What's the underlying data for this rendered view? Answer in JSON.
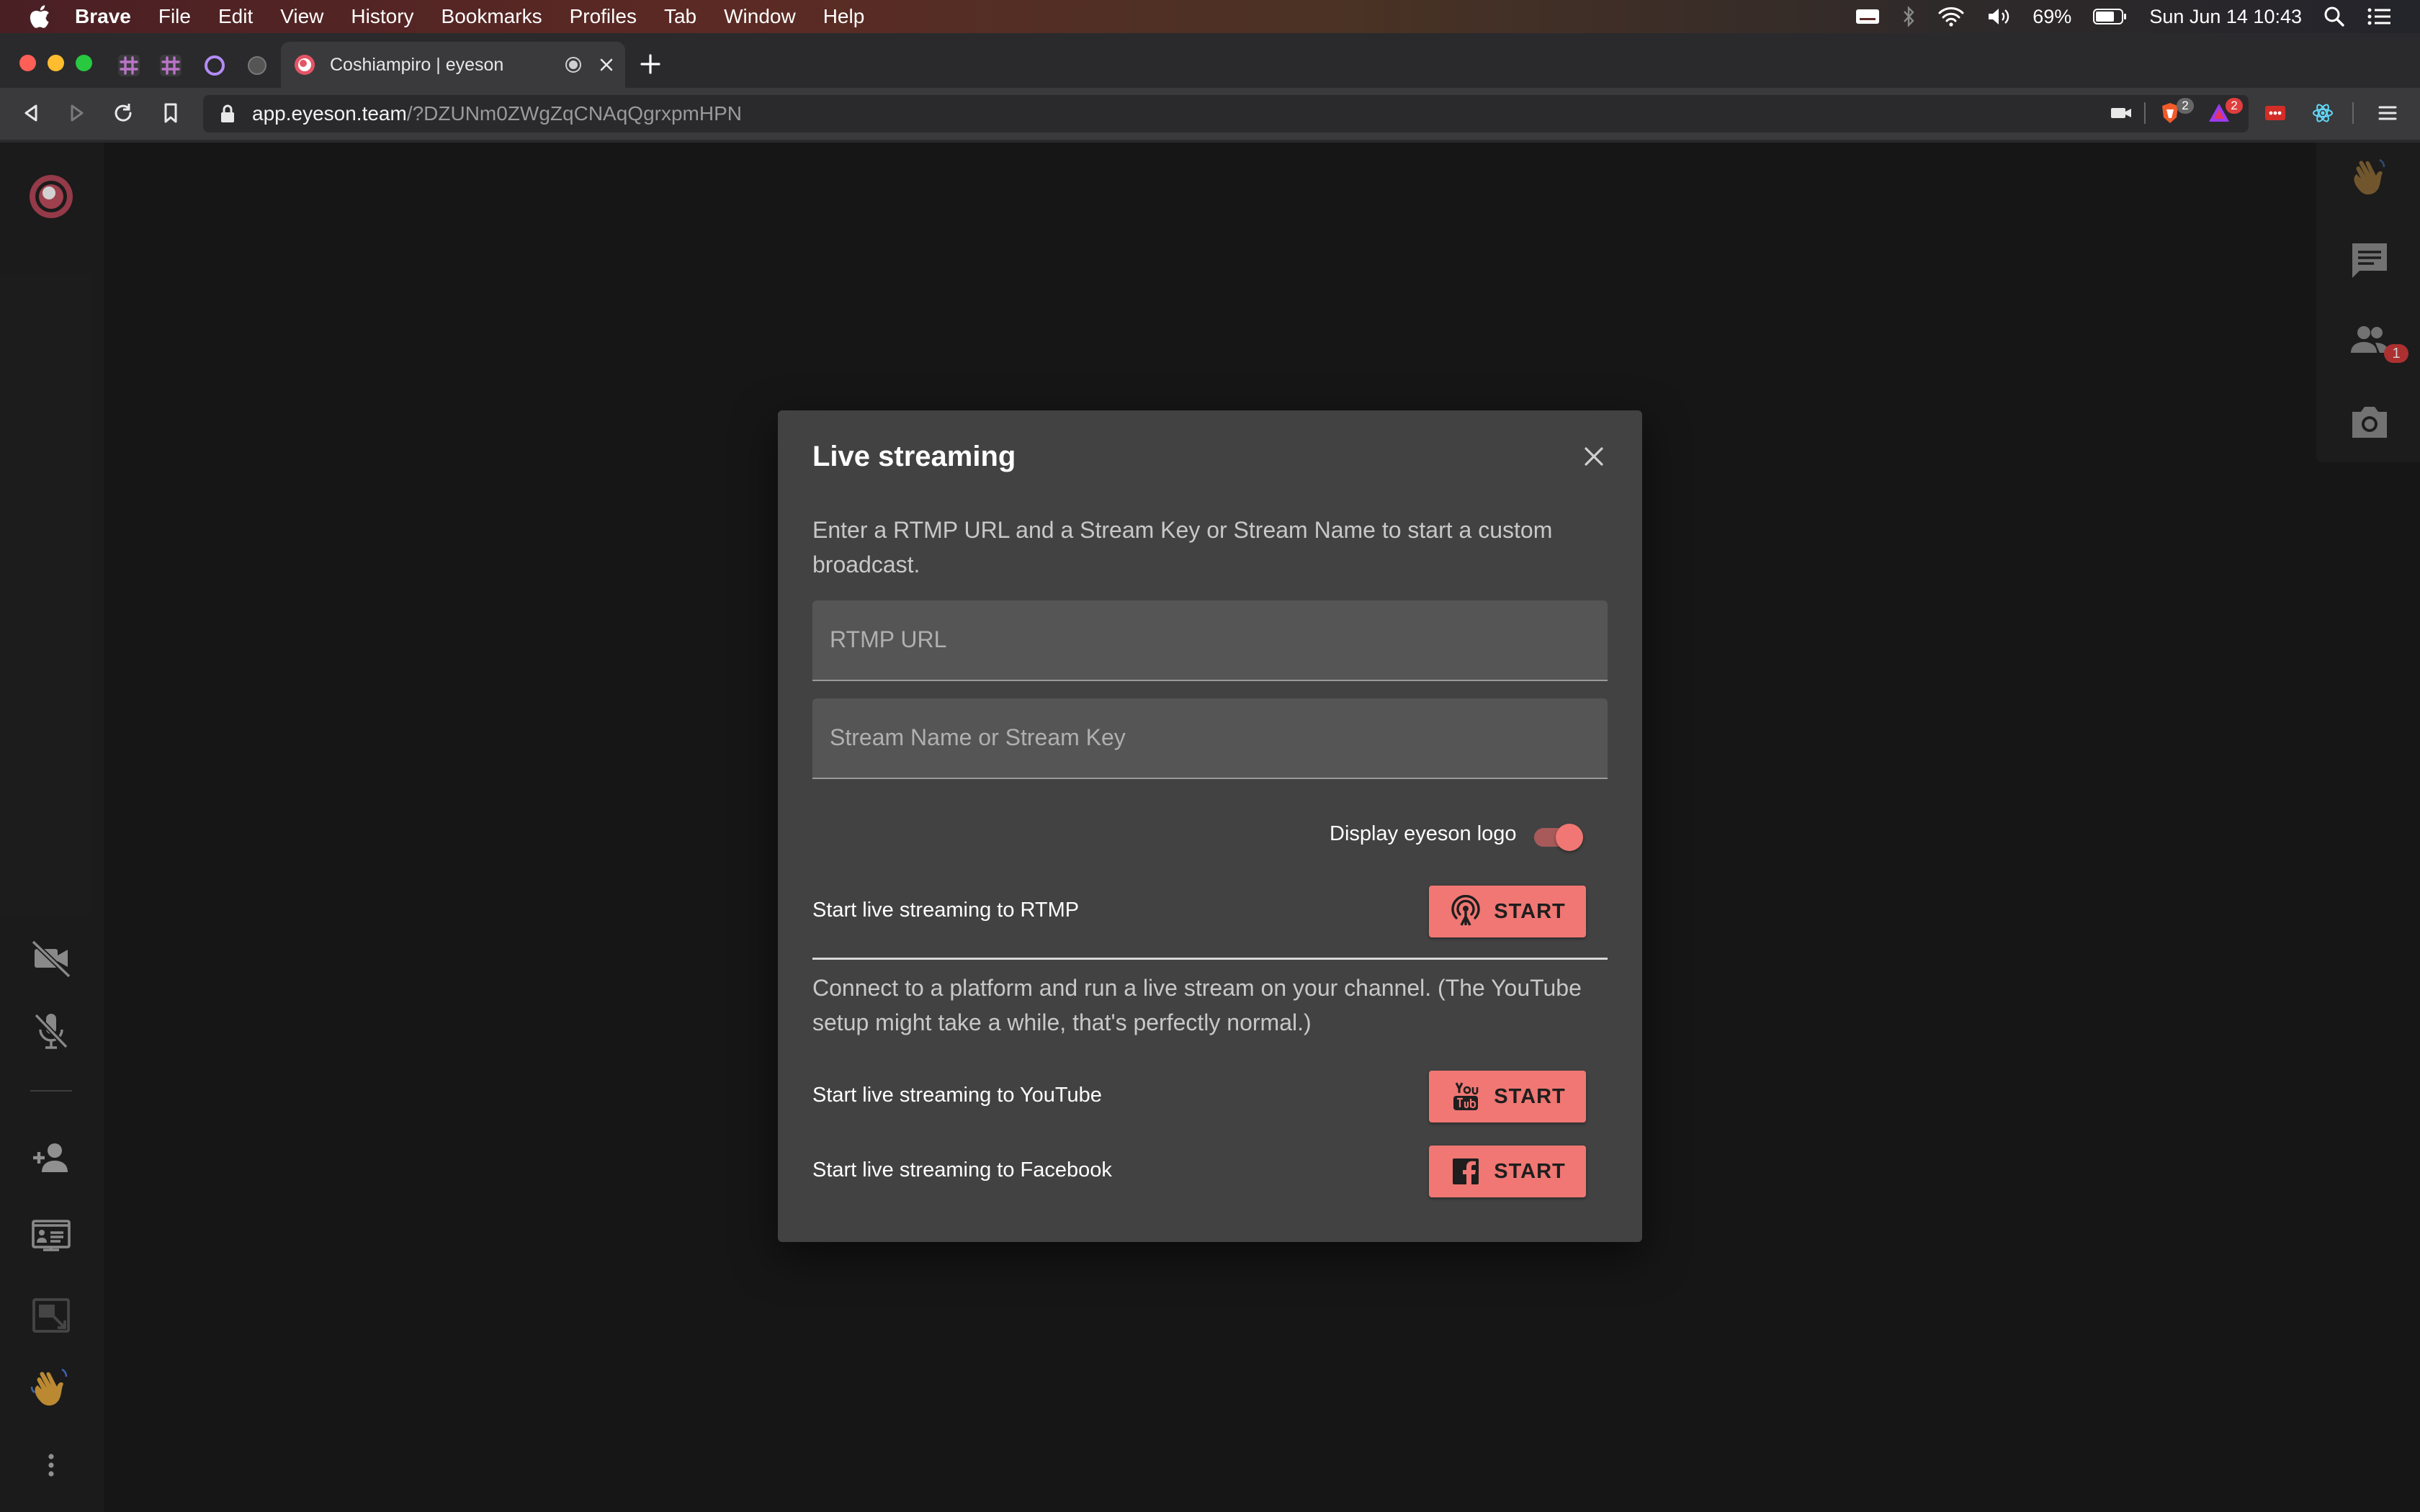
{
  "menubar": {
    "app_name": "Brave",
    "items": [
      "File",
      "Edit",
      "View",
      "History",
      "Bookmarks",
      "Profiles",
      "Tab",
      "Window",
      "Help"
    ],
    "battery": "69%",
    "datetime": "Sun Jun 14  10:43"
  },
  "browser": {
    "active_tab_title": "Coshiampiro | eyeson",
    "url_host": "app.eyeson.team",
    "url_path": "/?DZUNm0ZWgZqCNAqQgrxpmHPN",
    "brave_shield_count": "2",
    "rewards_count": "2"
  },
  "rightbar": {
    "participants_badge": "1"
  },
  "dialog": {
    "title": "Live streaming",
    "rtmp_description": "Enter a RTMP URL and a Stream Key or Stream Name to start a custom broadcast.",
    "rtmp_url_placeholder": "RTMP URL",
    "stream_key_placeholder": "Stream Name or Stream Key",
    "logo_toggle_label": "Display eyeson logo",
    "logo_toggle_on": true,
    "rtmp_row_label": "Start live streaming to RTMP",
    "platform_description": "Connect to a platform and run a live stream on your channel. (The YouTube setup might take a while, that's perfectly normal.)",
    "youtube_row_label": "Start live streaming to YouTube",
    "facebook_row_label": "Start live streaming to Facebook",
    "start_label": "START"
  },
  "colors": {
    "accent": "#f07773",
    "dialog_bg": "#424242",
    "app_bg": "#1b1b1b"
  }
}
